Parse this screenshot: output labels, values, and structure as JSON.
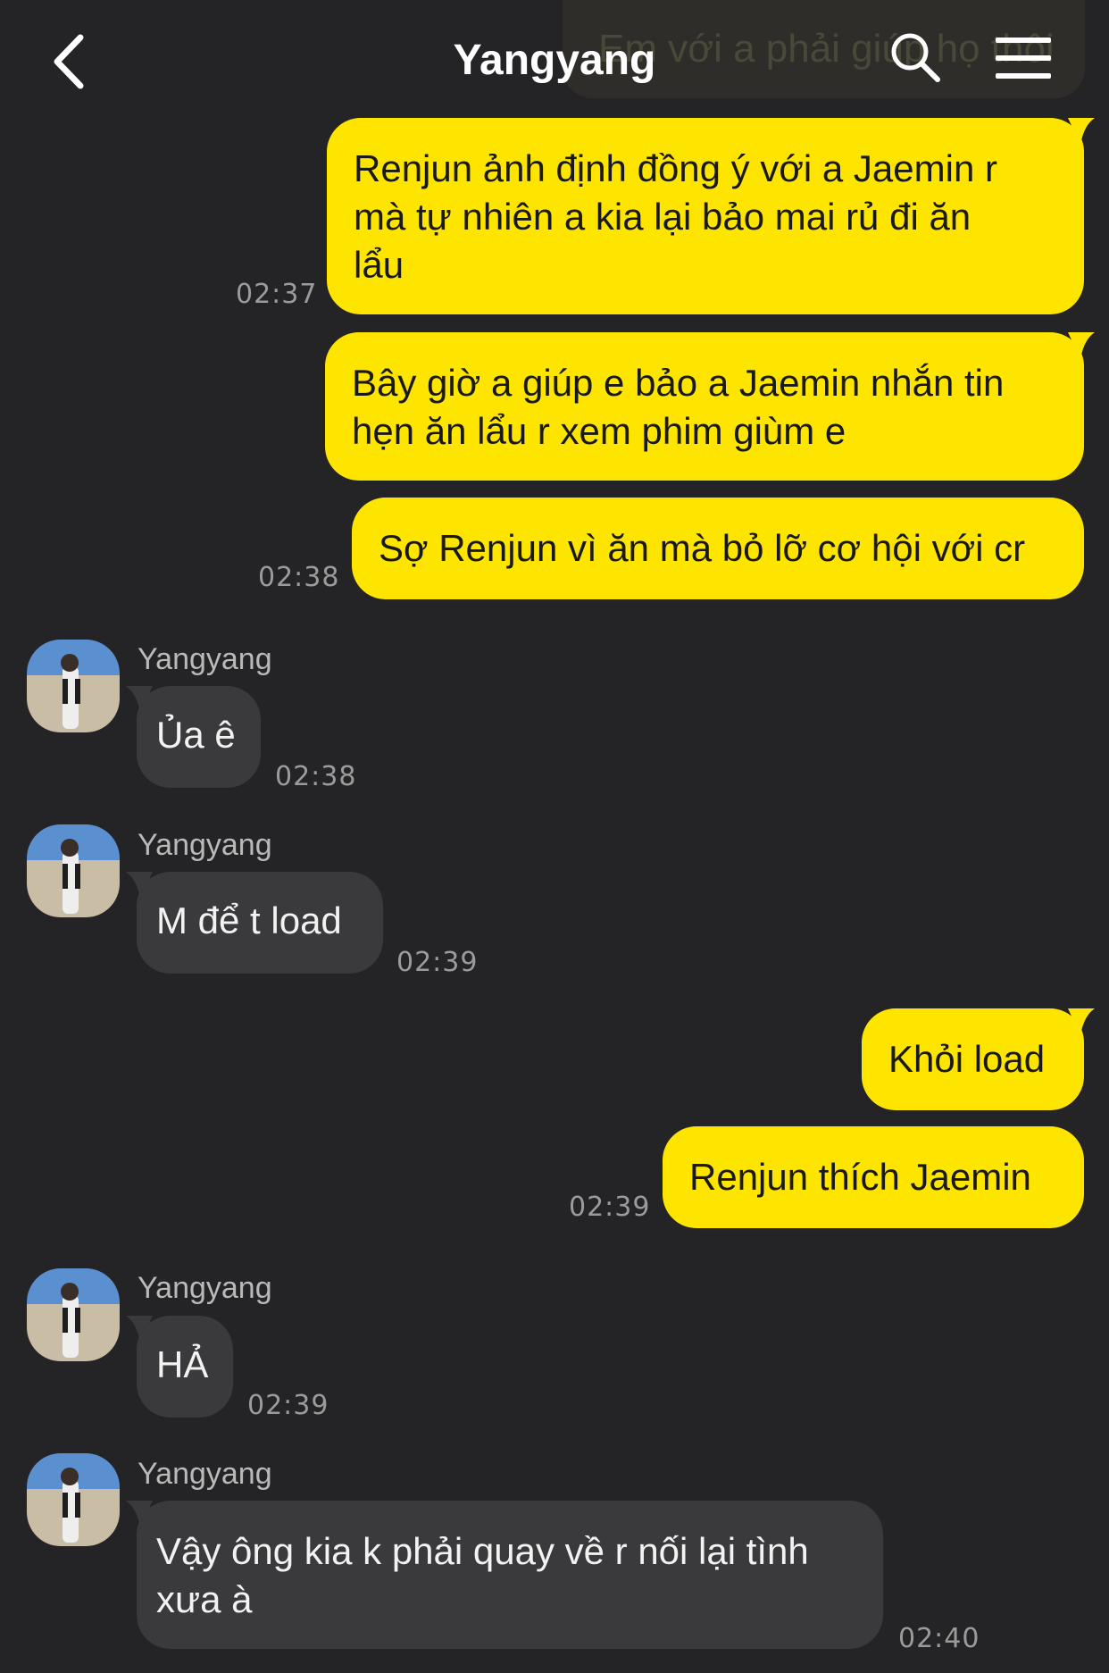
{
  "header": {
    "title": "Yangyang",
    "ghost_text": "Em với a phải giúp họ thôi"
  },
  "messages": {
    "m1_line1": "Renjun ảnh định đồng ý với a Jaemin r",
    "m1_line2": "mà tự nhiên a kia lại bảo mai rủ đi ăn",
    "m1_line3": "lẩu",
    "m1_time": "02:37",
    "m2_line1": "Bây giờ a giúp e bảo a Jaemin nhắn tin",
    "m2_line2": "hẹn ăn lẩu r xem phim giùm e",
    "m3_text": "Sợ Renjun vì ăn mà bỏ lỡ cơ hội với cr",
    "m3_time": "02:38",
    "sender": "Yangyang",
    "r1_text": "Ủa ê",
    "r1_time": "02:38",
    "r2_text": "M để t load",
    "r2_time": "02:39",
    "m4_text": "Khỏi load",
    "m5_text": "Renjun thích Jaemin",
    "m5_time": "02:39",
    "r3_text": "HẢ",
    "r3_time": "02:39",
    "r4_line1": "Vậy ông kia k phải quay về r nối lại tình",
    "r4_line2": "xưa à",
    "r4_time": "02:40"
  },
  "icons": {
    "back": "chevron-left-icon",
    "search": "search-icon",
    "menu": "hamburger-menu-icon",
    "avatar": "avatar-beach-photo"
  },
  "colors": {
    "background": "#242426",
    "outgoing_bubble": "#fee500",
    "incoming_bubble": "#3a3a3c",
    "timestamp": "#9b9b9b"
  }
}
